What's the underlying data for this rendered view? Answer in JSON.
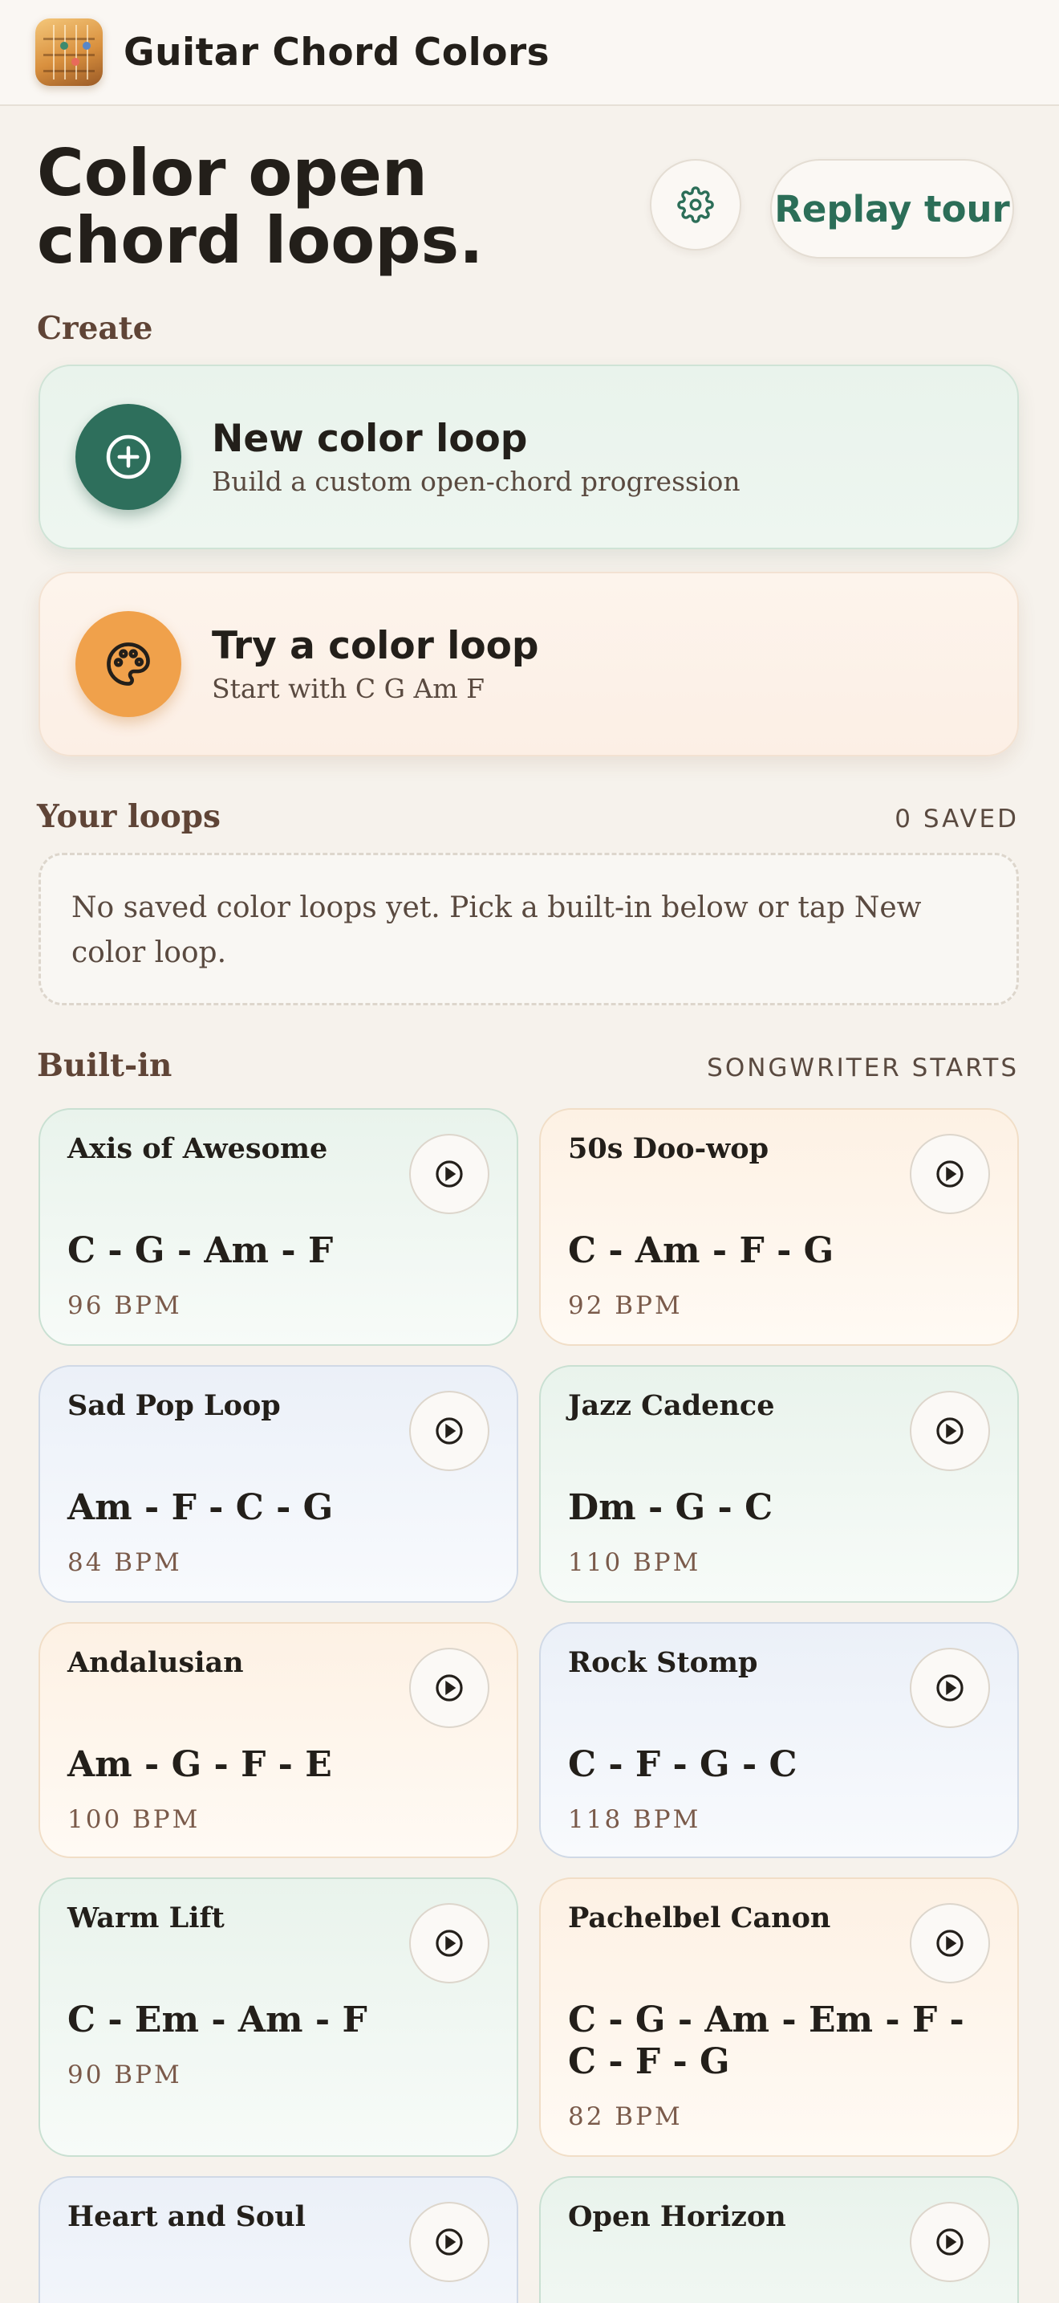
{
  "header": {
    "app_title": "Guitar Chord Colors"
  },
  "hero": {
    "title": "Color open chord loops.",
    "replay_label": "Replay tour"
  },
  "create": {
    "label": "Create",
    "new_loop": {
      "title": "New color loop",
      "subtitle": "Build a custom open-chord progression"
    },
    "try_loop": {
      "title": "Try a color loop",
      "subtitle": "Start with C G Am F"
    }
  },
  "your_loops": {
    "label": "Your loops",
    "count_label": "0 SAVED",
    "empty_message": "No saved color loops yet. Pick a built-in below or tap New color loop."
  },
  "builtin": {
    "label": "Built-in",
    "meta": "SONGWRITER STARTS",
    "loops": [
      {
        "name": "Axis of Awesome",
        "chords": "C - G - Am - F",
        "bpm": "96 BPM",
        "tint": "green"
      },
      {
        "name": "50s Doo-wop",
        "chords": "C - Am - F - G",
        "bpm": "92 BPM",
        "tint": "orange"
      },
      {
        "name": "Sad Pop Loop",
        "chords": "Am - F - C - G",
        "bpm": "84 BPM",
        "tint": "blue"
      },
      {
        "name": "Jazz Cadence",
        "chords": "Dm - G - C",
        "bpm": "110 BPM",
        "tint": "green"
      },
      {
        "name": "Andalusian",
        "chords": "Am - G - F - E",
        "bpm": "100 BPM",
        "tint": "orange"
      },
      {
        "name": "Rock Stomp",
        "chords": "C - F - G - C",
        "bpm": "118 BPM",
        "tint": "blue"
      },
      {
        "name": "Warm Lift",
        "chords": "C - Em - Am - F",
        "bpm": "90 BPM",
        "tint": "green"
      },
      {
        "name": "Pachelbel Canon",
        "chords": "C - G - Am - Em - F - C - F - G",
        "bpm": "82 BPM",
        "tint": "orange"
      },
      {
        "name": "Heart and Soul",
        "chords": "",
        "bpm": "",
        "tint": "blue"
      },
      {
        "name": "Open Horizon",
        "chords": "",
        "bpm": "",
        "tint": "green"
      }
    ]
  },
  "colors": {
    "accent_green": "#2e6f5c",
    "accent_orange": "#f0a14b",
    "background": "#f6f2ec"
  },
  "icons": {
    "settings": "gear-icon",
    "new_loop": "plus-circle-icon",
    "try_loop": "palette-icon",
    "play": "play-circle-icon"
  }
}
